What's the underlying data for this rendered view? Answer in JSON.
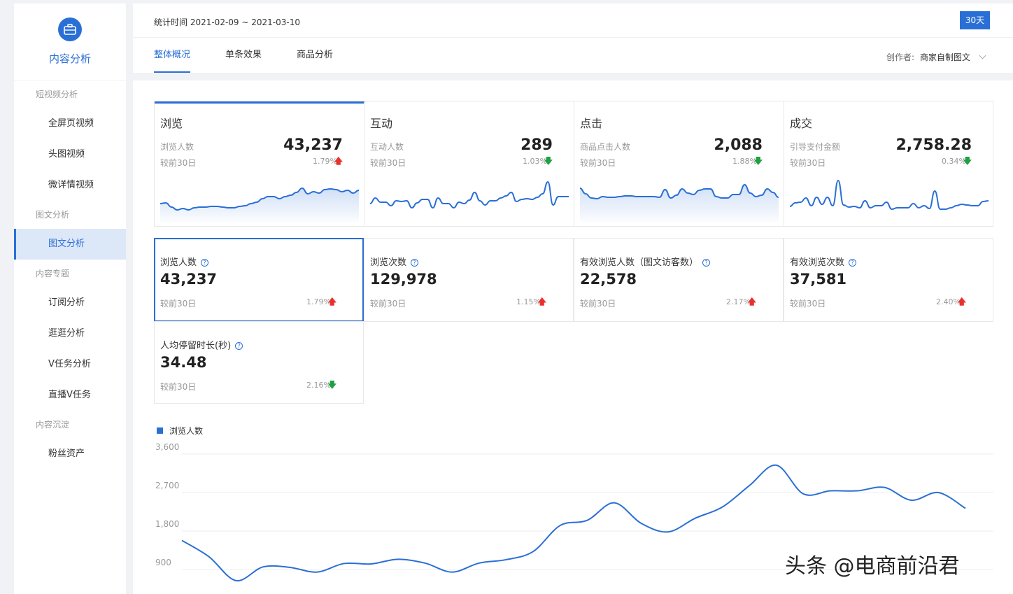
{
  "sidebar": {
    "title": "内容分析",
    "groups": [
      {
        "label": "短视频分析",
        "items": [
          "全屏页视频",
          "头图视频",
          "微详情视频"
        ]
      },
      {
        "label": "图文分析",
        "items": [
          "图文分析"
        ]
      },
      {
        "label": "内容专题",
        "items": [
          "订阅分析",
          "逛逛分析",
          "V任务分析",
          "直播V任务"
        ]
      },
      {
        "label": "内容沉淀",
        "items": [
          "粉丝资产"
        ]
      }
    ],
    "active_item": "图文分析"
  },
  "header": {
    "stat_time": "统计时间 2021-02-09 ~ 2021-03-10",
    "range_button": "30天",
    "tabs": [
      "整体概况",
      "单条效果",
      "商品分析"
    ],
    "active_tab": "整体概况",
    "creator_label": "创作者:",
    "creator_value": "商家自制图文"
  },
  "summary_cards": [
    {
      "title": "浏览",
      "sub": "浏览人数",
      "value": "43,237",
      "compare": "较前30日",
      "pct": "1.79%",
      "trend": "up",
      "spark": [
        34,
        33,
        39,
        43,
        41,
        43,
        40,
        39,
        39,
        38,
        38,
        39,
        40,
        40,
        38,
        37,
        34,
        32,
        27,
        24,
        24,
        27,
        24,
        22,
        18,
        12,
        20,
        17,
        19,
        14,
        13,
        14,
        17,
        15,
        19,
        15
      ]
    },
    {
      "title": "互动",
      "sub": "互动人数",
      "value": "289",
      "compare": "较前30日",
      "pct": "1.03%",
      "trend": "down",
      "spark": [
        34,
        26,
        32,
        32,
        37,
        30,
        31,
        30,
        40,
        33,
        28,
        28,
        40,
        26,
        34,
        34,
        40,
        32,
        34,
        29,
        18,
        30,
        36,
        30,
        30,
        26,
        23,
        18,
        31,
        28,
        27,
        28,
        25,
        20,
        3,
        36,
        24,
        24,
        24
      ]
    },
    {
      "title": "点击",
      "sub": "商品点击人数",
      "value": "2,088",
      "compare": "较前30日",
      "pct": "1.88%",
      "trend": "down",
      "spark": [
        12,
        20,
        26,
        27,
        24,
        25,
        25,
        24,
        23,
        23,
        24,
        24,
        24,
        24,
        25,
        14,
        26,
        22,
        13,
        19,
        21,
        15,
        13,
        13,
        24,
        26,
        26,
        21,
        21,
        7,
        19,
        24,
        22,
        13,
        18,
        25
      ]
    },
    {
      "title": "成交",
      "sub": "引导支付金额",
      "value": "2,758.28",
      "compare": "较前30日",
      "pct": "0.34%",
      "trend": "down",
      "spark": [
        38,
        33,
        32,
        26,
        37,
        25,
        35,
        25,
        37,
        1,
        36,
        39,
        38,
        40,
        30,
        40,
        37,
        37,
        32,
        42,
        40,
        40,
        40,
        34,
        40,
        37,
        41,
        16,
        42,
        42,
        40,
        37,
        35,
        36,
        37,
        37,
        31,
        30
      ]
    }
  ],
  "metric_cards": [
    {
      "title": "浏览人数",
      "value": "43,237",
      "compare": "较前30日",
      "pct": "1.79%",
      "trend": "up"
    },
    {
      "title": "浏览次数",
      "value": "129,978",
      "compare": "较前30日",
      "pct": "1.15%",
      "trend": "up"
    },
    {
      "title": "有效浏览人数（图文访客数）",
      "value": "22,578",
      "compare": "较前30日",
      "pct": "2.17%",
      "trend": "up"
    },
    {
      "title": "有效浏览次数",
      "value": "37,581",
      "compare": "较前30日",
      "pct": "2.40%",
      "trend": "up"
    },
    {
      "title": "人均停留时长(秒)",
      "value": "34.48",
      "compare": "较前30日",
      "pct": "2.16%",
      "trend": "down"
    }
  ],
  "arrows": {
    "up": "🡅",
    "down": "🡇"
  },
  "chart_data": {
    "type": "line",
    "series": [
      {
        "name": "浏览人数",
        "values": [
          1580,
          1200,
          640,
          960,
          950,
          840,
          1040,
          1030,
          1140,
          1050,
          840,
          1050,
          1130,
          1320,
          1930,
          2050,
          2460,
          1980,
          1780,
          2100,
          2360,
          2860,
          3340,
          2670,
          2740,
          2740,
          2820,
          2520,
          2700,
          2330
        ]
      }
    ],
    "ylim": [
      700,
      3600
    ],
    "yticks": [
      "3,600",
      "2,700",
      "1,800",
      "900"
    ],
    "grid": true,
    "color": "#2a6fd6"
  },
  "watermark": "头条 @电商前沿君"
}
